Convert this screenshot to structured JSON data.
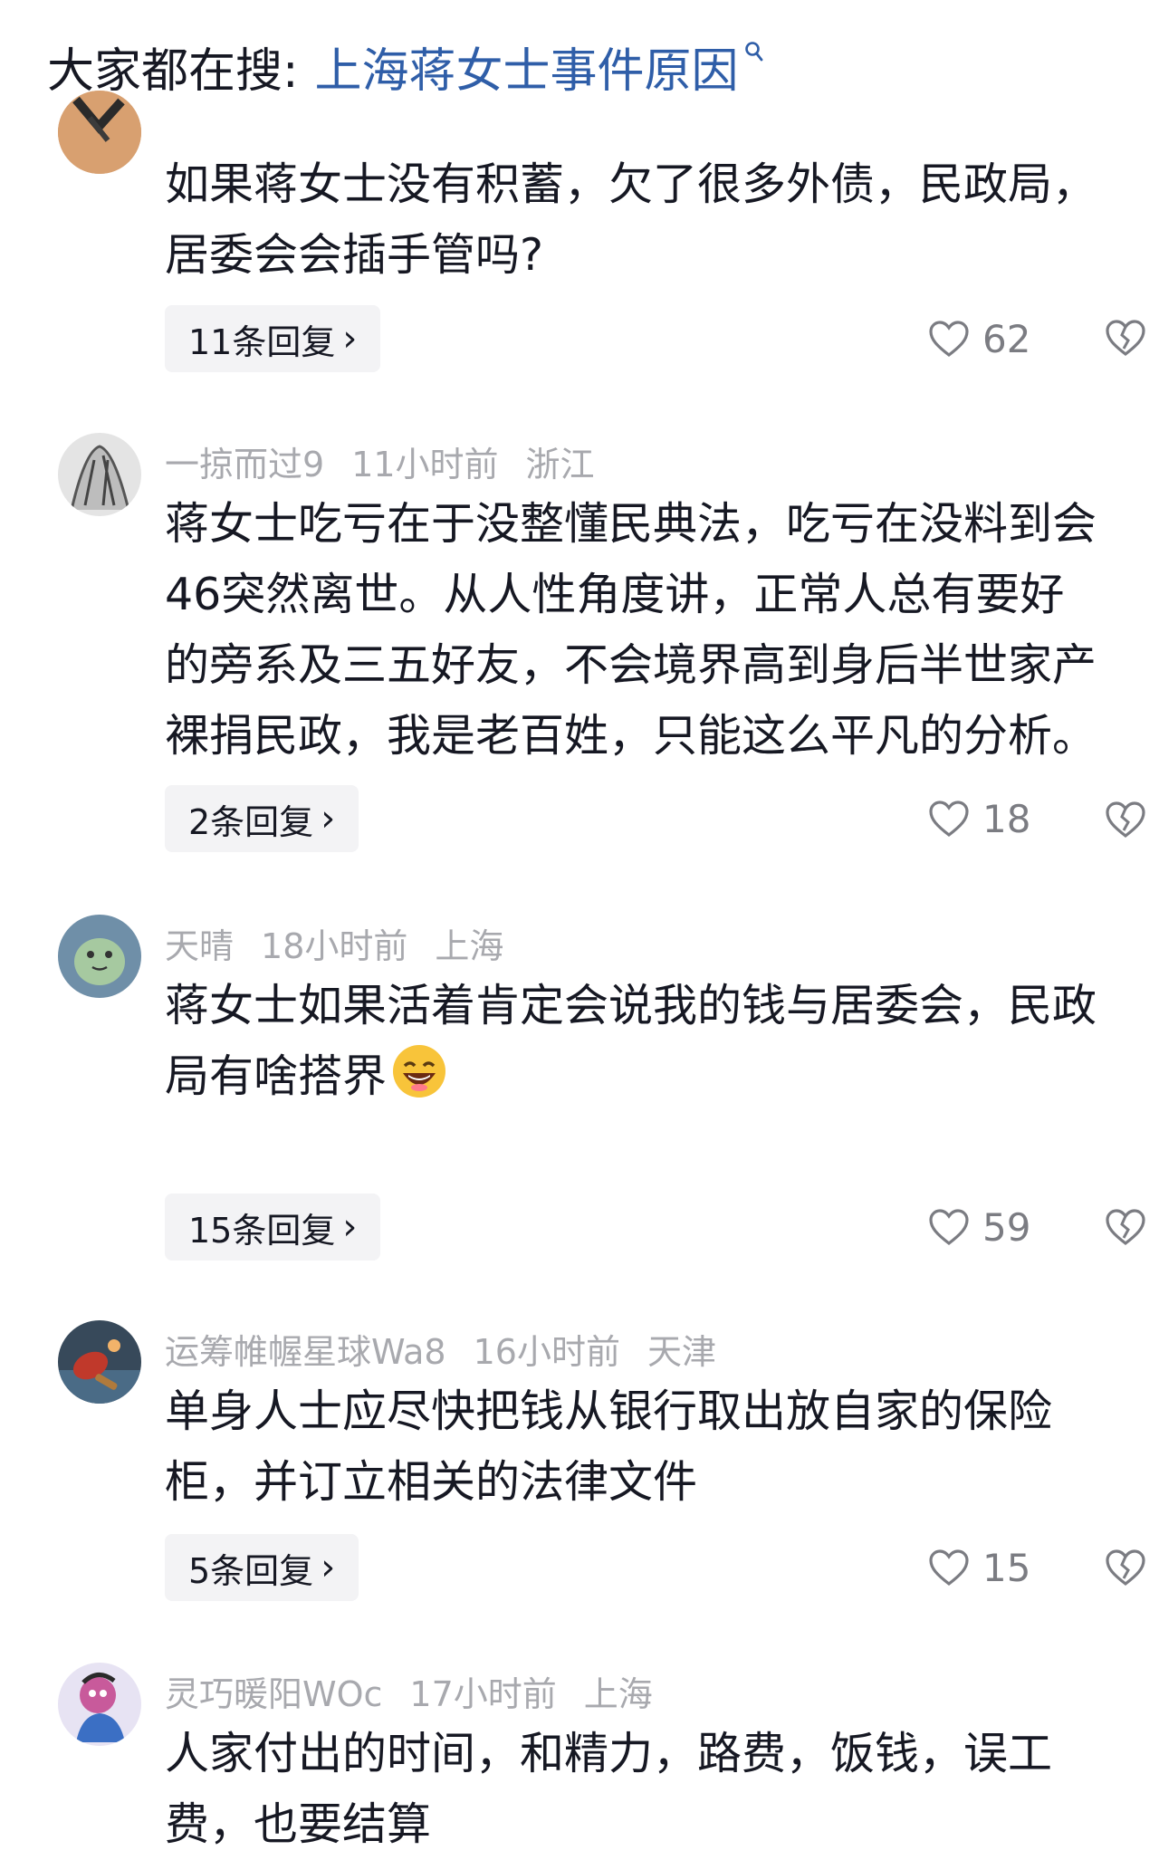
{
  "search": {
    "prefix": "大家都在搜:",
    "query": "上海蒋女士事件原因"
  },
  "comments": [
    {
      "text_lines": [
        "如果蒋女士没有积蓄，欠了很多外债，民政局，",
        "居委会会插手管吗?"
      ],
      "replies": "11条回复",
      "likes": "62"
    },
    {
      "username": "一掠而过9",
      "time": "11小时前",
      "location": "浙江",
      "text_lines": [
        "蒋女士吃亏在于没整懂民典法，吃亏在没料到会",
        "46突然离世。从人性角度讲，正常人总有要好",
        "的旁系及三五好友，不会境界高到身后半世家产",
        "裸捐民政，我是老百姓，只能这么平凡的分析。"
      ],
      "replies": "2条回复",
      "likes": "18"
    },
    {
      "username": "天晴",
      "time": "18小时前",
      "location": "上海",
      "text_lines": [
        "蒋女士如果活着肯定会说我的钱与居委会，民政",
        "局有啥搭界"
      ],
      "replies": "15条回复",
      "likes": "59"
    },
    {
      "username": "运筹帷幄星球Wa8",
      "time": "16小时前",
      "location": "天津",
      "text_lines": [
        "单身人士应尽快把钱从银行取出放自家的保险",
        "柜，并订立相关的法律文件"
      ],
      "replies": "5条回复",
      "likes": "15"
    },
    {
      "username": "灵巧暖阳WOc",
      "time": "17小时前",
      "location": "上海",
      "text_lines": [
        "人家付出的时间，和精力，路费，饭钱，误工",
        "费，也要结算"
      ]
    }
  ],
  "icons": {
    "like": "heart-outline-icon",
    "dislike": "broken-heart-icon",
    "search": "search-icon",
    "reply_more": "chevron-right-icon",
    "emoji": "laughing-emoji-icon"
  },
  "colors": {
    "link": "#2f5ea8",
    "meta": "#a8a9ae",
    "reply_bg": "#f3f3f5"
  }
}
